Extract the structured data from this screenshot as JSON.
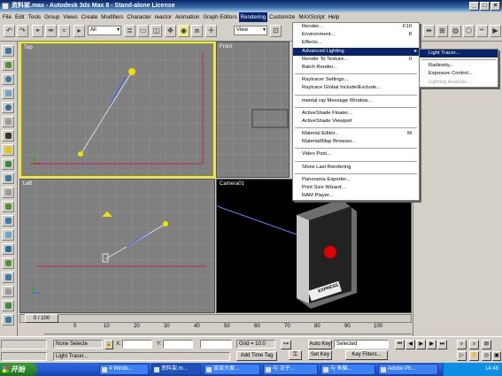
{
  "window": {
    "title": "资料架.max - Autodesk 3ds Max 8 - Stand-alone License",
    "min": "_",
    "max": "□",
    "close": "×"
  },
  "menubar": [
    "File",
    "Edit",
    "Tools",
    "Group",
    "Views",
    "Create",
    "Modifiers",
    "Character",
    "reactor",
    "Animation",
    "Graph Editors",
    "Rendering",
    "Customize",
    "MAXScript",
    "Help"
  ],
  "toolbar": {
    "selection_filter": "All",
    "ref_coord": "View"
  },
  "viewports": {
    "top": "Top",
    "front": "Front",
    "left": "Left",
    "camera": "Camera01"
  },
  "camera_scene": {
    "box_label": "EXPRESS"
  },
  "rendering_menu": {
    "groups": [
      [
        {
          "label": "Render...",
          "shortcut": "F10"
        },
        {
          "label": "Environment...",
          "shortcut": "8"
        },
        {
          "label": "Effects..."
        },
        {
          "label": "Advanced Lighting",
          "submenu": true,
          "highlighted": true
        },
        {
          "label": "Render To Texture...",
          "shortcut": "0"
        },
        {
          "label": "Batch Render..."
        }
      ],
      [
        {
          "label": "Raytracer Settings..."
        },
        {
          "label": "Raytrace Global Include/Exclude..."
        }
      ],
      [
        {
          "label": "mental ray Message Window..."
        }
      ],
      [
        {
          "label": "ActiveShade Floater..."
        },
        {
          "label": "ActiveShade Viewport"
        }
      ],
      [
        {
          "label": "Material Editor...",
          "shortcut": "M"
        },
        {
          "label": "Material/Map Browser..."
        }
      ],
      [
        {
          "label": "Video Post..."
        }
      ],
      [
        {
          "label": "Show Last Rendering"
        }
      ],
      [
        {
          "label": "Panorama Exporter..."
        },
        {
          "label": "Print Size Wizard..."
        },
        {
          "label": "RAM Player..."
        }
      ]
    ]
  },
  "advanced_lighting_submenu": [
    {
      "label": "Light Tracer...",
      "highlighted": true
    },
    {
      "sep": true
    },
    {
      "label": "Radiosity..."
    },
    {
      "label": "Exposure Control..."
    },
    {
      "label": "Lighting Analysis...",
      "disabled": true
    }
  ],
  "timeline": {
    "slider": "0 / 100",
    "ticks": [
      "0",
      "10",
      "20",
      "30",
      "40",
      "50",
      "60",
      "70",
      "80",
      "90",
      "100"
    ]
  },
  "status": {
    "selection": "None Selecte",
    "x_label": "X:",
    "y_label": "Y:",
    "grid": "Grid = 10.0",
    "auto_key": "Auto Key",
    "set_key": "Set Key",
    "key_mode": "Selected",
    "key_filters": "Key Filters...",
    "add_time_tag": "Add Time Tag",
    "prompt": "Light Tracer..."
  },
  "taskbar": {
    "start": "开始",
    "tasks": [
      "4 Windo...",
      "资料架.m...",
      "谈谈大家...",
      "与 次子...",
      "与 鱼脑...",
      "Adobe Ph..."
    ],
    "clock": "14:48"
  }
}
